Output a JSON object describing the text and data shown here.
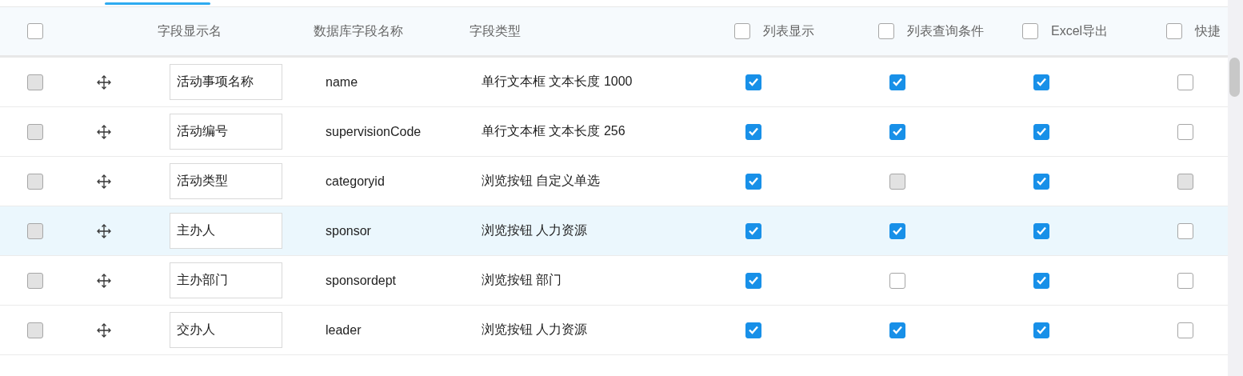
{
  "header": [
    {
      "kind": "checkbox",
      "checked": false
    },
    {
      "kind": "label",
      "label": "字段显示名"
    },
    {
      "kind": "label",
      "label": "数据库字段名称"
    },
    {
      "kind": "label",
      "label": "字段类型"
    },
    {
      "kind": "checkbox_label",
      "label": "列表显示",
      "checked": false
    },
    {
      "kind": "checkbox_label",
      "label": "列表查询条件",
      "checked": false
    },
    {
      "kind": "checkbox_label",
      "label": "Excel导出",
      "checked": false
    },
    {
      "kind": "checkbox_label",
      "label": "快捷",
      "checked": false
    }
  ],
  "rows": [
    {
      "selected": false,
      "select": {
        "checked": false,
        "disabled": true
      },
      "display_name": "活动事项名称",
      "db_field": "name",
      "field_type": "单行文本框 文本长度 1000",
      "list_display": {
        "checked": true,
        "disabled": false
      },
      "list_query": {
        "checked": true,
        "disabled": false
      },
      "excel_export": {
        "checked": true,
        "disabled": false
      },
      "quick": {
        "checked": false,
        "disabled": false
      }
    },
    {
      "selected": false,
      "select": {
        "checked": false,
        "disabled": true
      },
      "display_name": "活动编号",
      "db_field": "supervisionCode",
      "field_type": "单行文本框 文本长度 256",
      "list_display": {
        "checked": true,
        "disabled": false
      },
      "list_query": {
        "checked": true,
        "disabled": false
      },
      "excel_export": {
        "checked": true,
        "disabled": false
      },
      "quick": {
        "checked": false,
        "disabled": false
      }
    },
    {
      "selected": false,
      "select": {
        "checked": false,
        "disabled": true
      },
      "display_name": "活动类型",
      "db_field": "categoryid",
      "field_type": "浏览按钮 自定义单选",
      "list_display": {
        "checked": true,
        "disabled": false
      },
      "list_query": {
        "checked": false,
        "disabled": true
      },
      "excel_export": {
        "checked": true,
        "disabled": false
      },
      "quick": {
        "checked": false,
        "disabled": true
      }
    },
    {
      "selected": true,
      "select": {
        "checked": false,
        "disabled": true
      },
      "display_name": "主办人",
      "db_field": "sponsor",
      "field_type": "浏览按钮 人力资源",
      "list_display": {
        "checked": true,
        "disabled": false
      },
      "list_query": {
        "checked": true,
        "disabled": false
      },
      "excel_export": {
        "checked": true,
        "disabled": false
      },
      "quick": {
        "checked": false,
        "disabled": false
      }
    },
    {
      "selected": false,
      "select": {
        "checked": false,
        "disabled": true
      },
      "display_name": "主办部门",
      "db_field": "sponsordept",
      "field_type": "浏览按钮 部门",
      "list_display": {
        "checked": true,
        "disabled": false
      },
      "list_query": {
        "checked": false,
        "disabled": false
      },
      "excel_export": {
        "checked": true,
        "disabled": false
      },
      "quick": {
        "checked": false,
        "disabled": false
      }
    },
    {
      "selected": false,
      "select": {
        "checked": false,
        "disabled": true
      },
      "display_name": "交办人",
      "db_field": "leader",
      "field_type": "浏览按钮 人力资源",
      "list_display": {
        "checked": true,
        "disabled": false
      },
      "list_query": {
        "checked": true,
        "disabled": false
      },
      "excel_export": {
        "checked": true,
        "disabled": false
      },
      "quick": {
        "checked": false,
        "disabled": false
      }
    }
  ]
}
